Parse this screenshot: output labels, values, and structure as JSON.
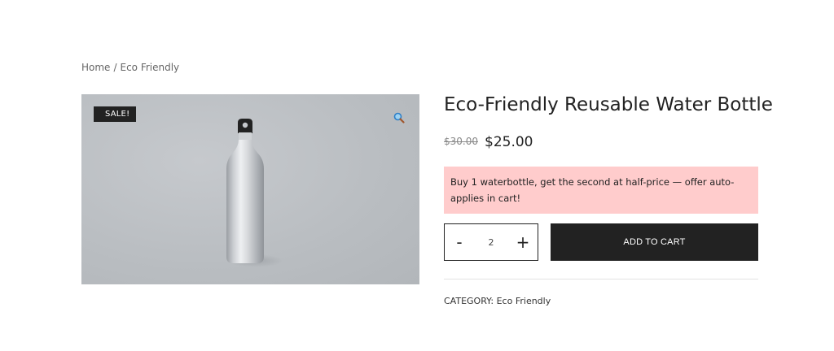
{
  "breadcrumb": {
    "home": "Home",
    "separator": "/",
    "current": "Eco Friendly"
  },
  "gallery": {
    "sale_badge": "SALE!",
    "zoom_icon": "magnifier-icon",
    "background_color": "#b9bcc0"
  },
  "product": {
    "title": "Eco-Friendly Reusable Water Bottle",
    "old_price": "$30.00",
    "new_price": "$25.00",
    "promo_message": "Buy 1 waterbottle, get the second at half-price — offer auto-applies in cart!"
  },
  "cart": {
    "minus_label": "-",
    "plus_label": "+",
    "quantity": "2",
    "add_to_cart_label": "ADD TO CART"
  },
  "meta": {
    "category_label": "CATEGORY:",
    "category_value": "Eco Friendly"
  },
  "colors": {
    "promo_bg": "#ffcccc",
    "button_bg": "#222222",
    "accent_zoom": "#2e7fc7"
  }
}
